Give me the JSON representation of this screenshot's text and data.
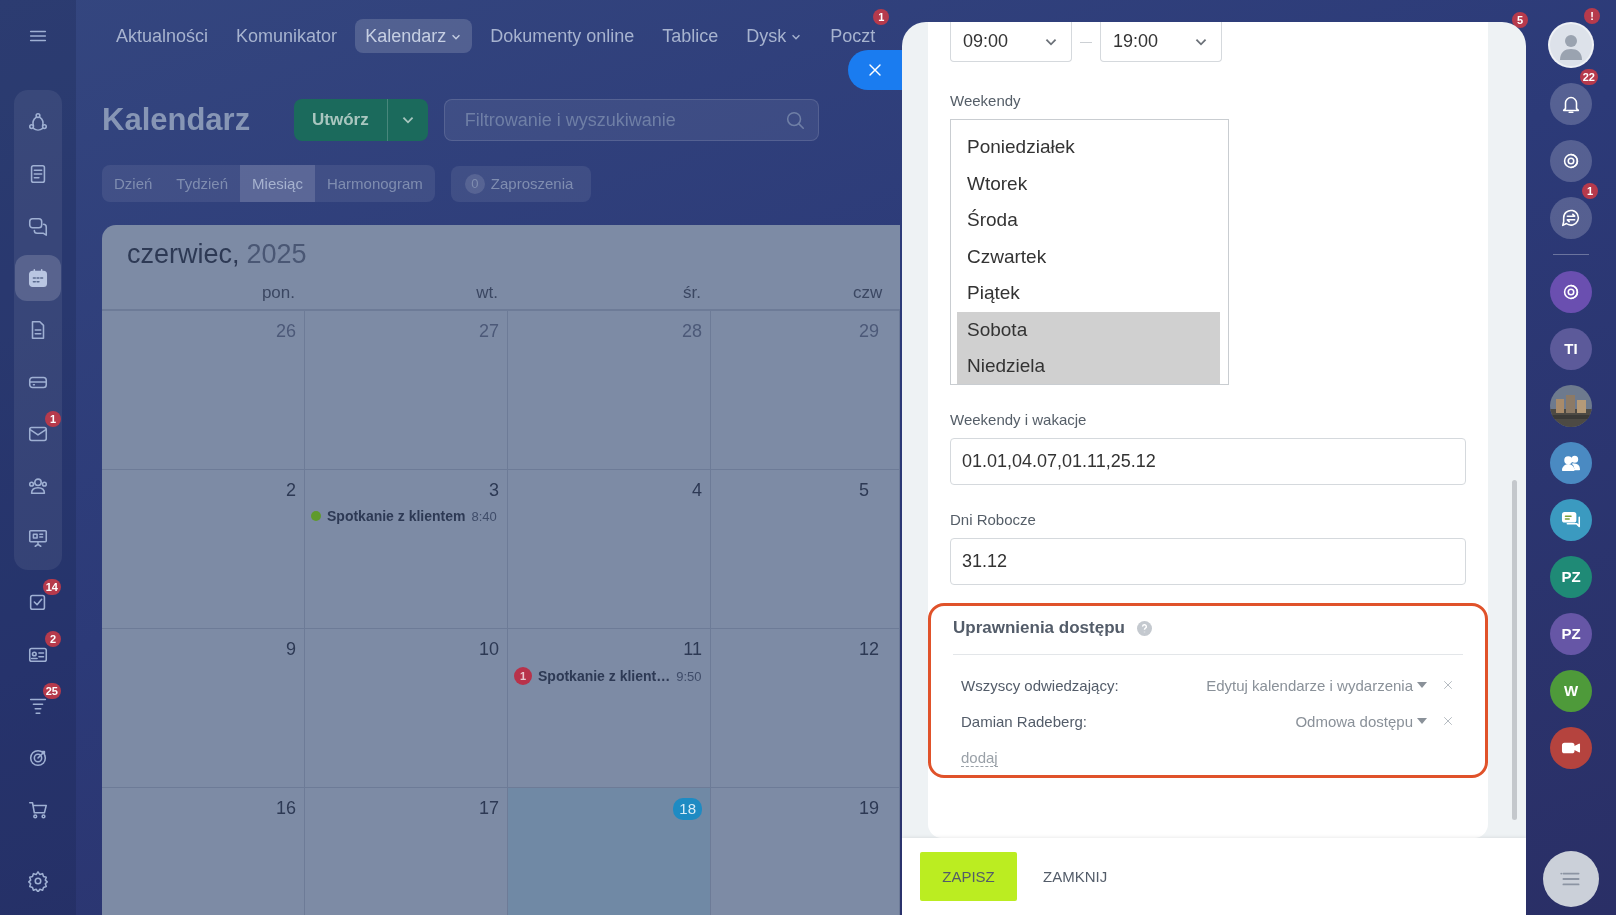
{
  "top_nav": {
    "items": [
      {
        "label": "Aktualności",
        "selected": false,
        "dropdown": false
      },
      {
        "label": "Komunikator",
        "selected": false,
        "dropdown": false
      },
      {
        "label": "Kalendarz",
        "selected": true,
        "dropdown": true
      },
      {
        "label": "Dokumenty online",
        "selected": false,
        "dropdown": false
      },
      {
        "label": "Tablice",
        "selected": false,
        "dropdown": false
      },
      {
        "label": "Dysk",
        "selected": false,
        "dropdown": true
      },
      {
        "label": "Poczt",
        "selected": false,
        "dropdown": false,
        "badge": "1"
      }
    ]
  },
  "left_sidebar": {
    "pinned": [
      {
        "selected": false
      },
      {
        "selected": false
      },
      {
        "selected": false
      },
      {
        "selected": true
      },
      {
        "selected": false
      },
      {
        "selected": false
      },
      {
        "selected": false,
        "badge": "1"
      },
      {
        "selected": false
      },
      {
        "selected": false
      }
    ],
    "more": [
      {
        "selected": false,
        "badge": "14"
      },
      {
        "selected": false,
        "badge": "2"
      },
      {
        "selected": false,
        "badge": "25"
      },
      {
        "selected": false
      },
      {
        "selected": false
      }
    ]
  },
  "calendar": {
    "title": "Kalendarz",
    "create_button": "Utwórz",
    "search": {
      "placeholder": "Filtrowanie i wyszukiwanie"
    },
    "views": [
      {
        "label": "Dzień",
        "selected": false
      },
      {
        "label": "Tydzień",
        "selected": false
      },
      {
        "label": "Miesiąc",
        "selected": true
      },
      {
        "label": "Harmonogram",
        "selected": false
      }
    ],
    "invitations": {
      "count": "0",
      "label": "Zaproszenia"
    },
    "month": "czerwiec,",
    "year": "2025",
    "weekdays": [
      "pon.",
      "wt.",
      "śr.",
      "czw"
    ],
    "weeks": [
      [
        {
          "day": "26",
          "other_month": true,
          "today": false
        },
        {
          "day": "27",
          "other_month": true,
          "today": false
        },
        {
          "day": "28",
          "other_month": true,
          "today": false
        },
        {
          "day": "29",
          "other_month": true,
          "today": false
        }
      ],
      [
        {
          "day": "2",
          "other_month": false,
          "today": false
        },
        {
          "day": "3",
          "other_month": false,
          "today": false,
          "events": [
            {
              "title": "Spotkanie z klientem",
              "time": "8:40",
              "color": "#5f9a2c"
            }
          ]
        },
        {
          "day": "4",
          "other_month": false,
          "today": false
        },
        {
          "day": "5",
          "other_month": false,
          "today": false
        }
      ],
      [
        {
          "day": "9",
          "other_month": false,
          "today": false
        },
        {
          "day": "10",
          "other_month": false,
          "today": false
        },
        {
          "day": "11",
          "other_month": false,
          "today": false,
          "events": [
            {
              "title": "Spotkanie z klient…",
              "time": "9:50",
              "color": "#b8324a",
              "badge": "1"
            }
          ]
        },
        {
          "day": "12",
          "other_month": false,
          "today": false
        }
      ],
      [
        {
          "day": "16",
          "other_month": false,
          "today": false
        },
        {
          "day": "17",
          "other_month": false,
          "today": false
        },
        {
          "day": "18",
          "other_month": false,
          "today": true
        },
        {
          "day": "19",
          "other_month": false,
          "today": false
        }
      ]
    ]
  },
  "settings_panel": {
    "work_time": {
      "from": "09:00",
      "to": "19:00"
    },
    "weekends": {
      "label": "Weekendy",
      "days": [
        {
          "label": "Poniedziałek",
          "selected": false
        },
        {
          "label": "Wtorek",
          "selected": false
        },
        {
          "label": "Środa",
          "selected": false
        },
        {
          "label": "Czwartek",
          "selected": false
        },
        {
          "label": "Piątek",
          "selected": false
        },
        {
          "label": "Sobota",
          "selected": true
        },
        {
          "label": "Niedziela",
          "selected": true
        }
      ]
    },
    "holidays": {
      "label": "Weekendy i wakacje",
      "value": "01.01,04.07,01.11,25.12"
    },
    "workdays": {
      "label": "Dni Robocze",
      "value": "31.12"
    },
    "access": {
      "title": "Uprawnienia dostępu",
      "rules": [
        {
          "name": "Wszyscy odwiedzający:",
          "permission": "Edytuj kalendarze i wydarzenia"
        },
        {
          "name": "Damian Radeberg:",
          "permission": "Odmowa dostępu"
        }
      ],
      "add_link": "dodaj"
    },
    "buttons": [
      {
        "label": "ZAPISZ",
        "kind": "primary"
      },
      {
        "label": "ZAMKNIJ",
        "kind": "link"
      }
    ]
  },
  "right_sidebar": {
    "overflow_badge": "5",
    "items": [
      {
        "kind": "avatar",
        "badge": "!"
      },
      {
        "kind": "icon",
        "badge": "22"
      },
      {
        "kind": "icon"
      },
      {
        "kind": "icon",
        "badge": "1"
      },
      {
        "kind": "divider"
      },
      {
        "kind": "icon",
        "color": "#6a4fb0"
      },
      {
        "kind": "initials",
        "text": "TI",
        "color": "#5c5a9a"
      },
      {
        "kind": "picture"
      },
      {
        "kind": "icon",
        "color": "#4a8ac2"
      },
      {
        "kind": "icon",
        "color": "#3b9ac0"
      },
      {
        "kind": "initials",
        "text": "PZ",
        "color": "#1f8a76"
      },
      {
        "kind": "initials",
        "text": "PZ",
        "color": "#6656a6"
      },
      {
        "kind": "initials",
        "text": "W",
        "color": "#4e9a3a"
      },
      {
        "kind": "icon",
        "color": "#b5433e"
      }
    ]
  }
}
